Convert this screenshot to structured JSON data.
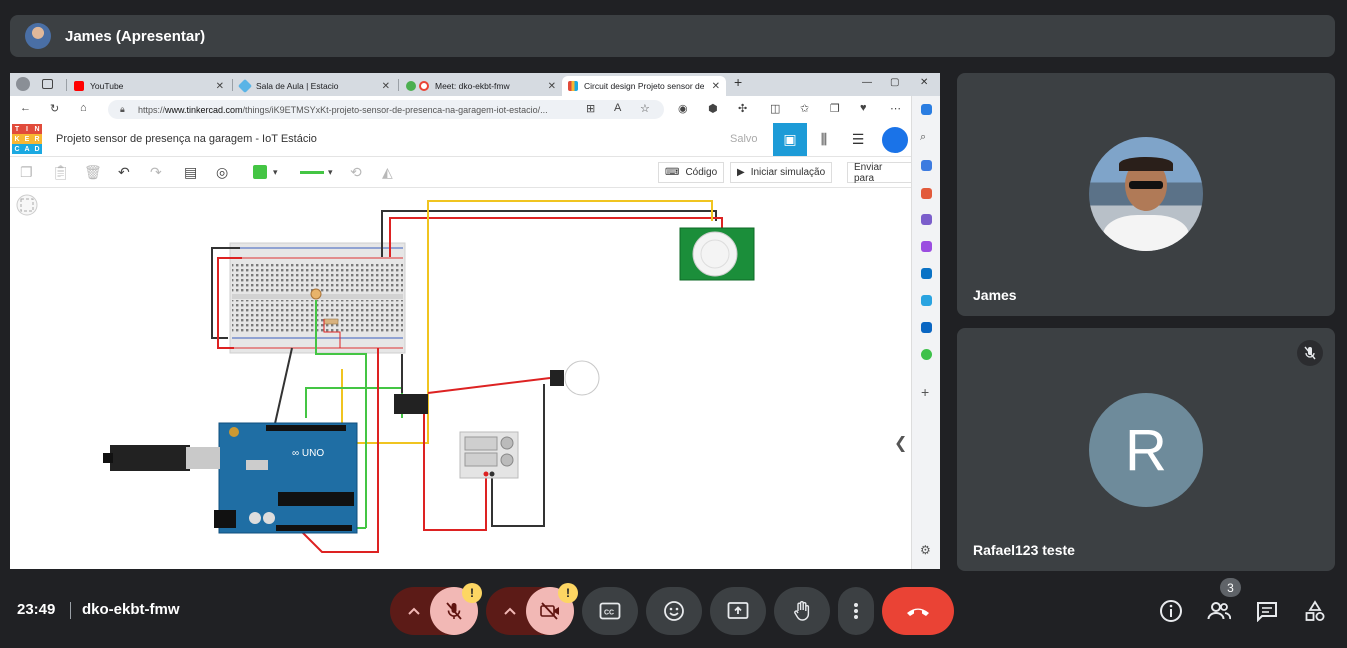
{
  "presenter": {
    "label": "James (Apresentar)"
  },
  "browser": {
    "tabs": [
      {
        "label": "YouTube",
        "color": "#ff0000"
      },
      {
        "label": "Sala de Aula | Estacio",
        "color": "#5ab4e6"
      },
      {
        "label": "Meet: dko-ekbt-fmw",
        "color": "#ea4335"
      },
      {
        "label": "Circuit design Projeto sensor de",
        "color": "#f4b400"
      }
    ],
    "url_prefix": "https://",
    "url_host": "www.tinkercad.com",
    "url_path": "/things/iK9ETMSYxKt-projeto-sensor-de-presenca-na-garagem-iot-estacio/..."
  },
  "tinkercad": {
    "logo_letters": [
      "T",
      "I",
      "N",
      "K",
      "E",
      "R",
      "C",
      "A",
      "D"
    ],
    "logo_colors": [
      "#e14b3b",
      "#e14b3b",
      "#e14b3b",
      "#f7b733",
      "#f7b733",
      "#f7b733",
      "#1ba9e1",
      "#1ba9e1",
      "#1ba9e1"
    ],
    "title": "Projeto sensor de presença na garagem - IoT Estácio",
    "saved": "Salvo",
    "code_button": "Código",
    "simulate_button": "Iniciar simulação",
    "send_button": "Enviar para",
    "accent": "#1d9bd7"
  },
  "participants": [
    {
      "name": "James"
    },
    {
      "name": "Rafael123 teste",
      "initial": "R",
      "avatar_color": "#6e8b9b"
    }
  ],
  "footer": {
    "time": "23:49",
    "meeting_code": "dko-ekbt-fmw",
    "participant_count": "3",
    "warning_mark": "!"
  }
}
